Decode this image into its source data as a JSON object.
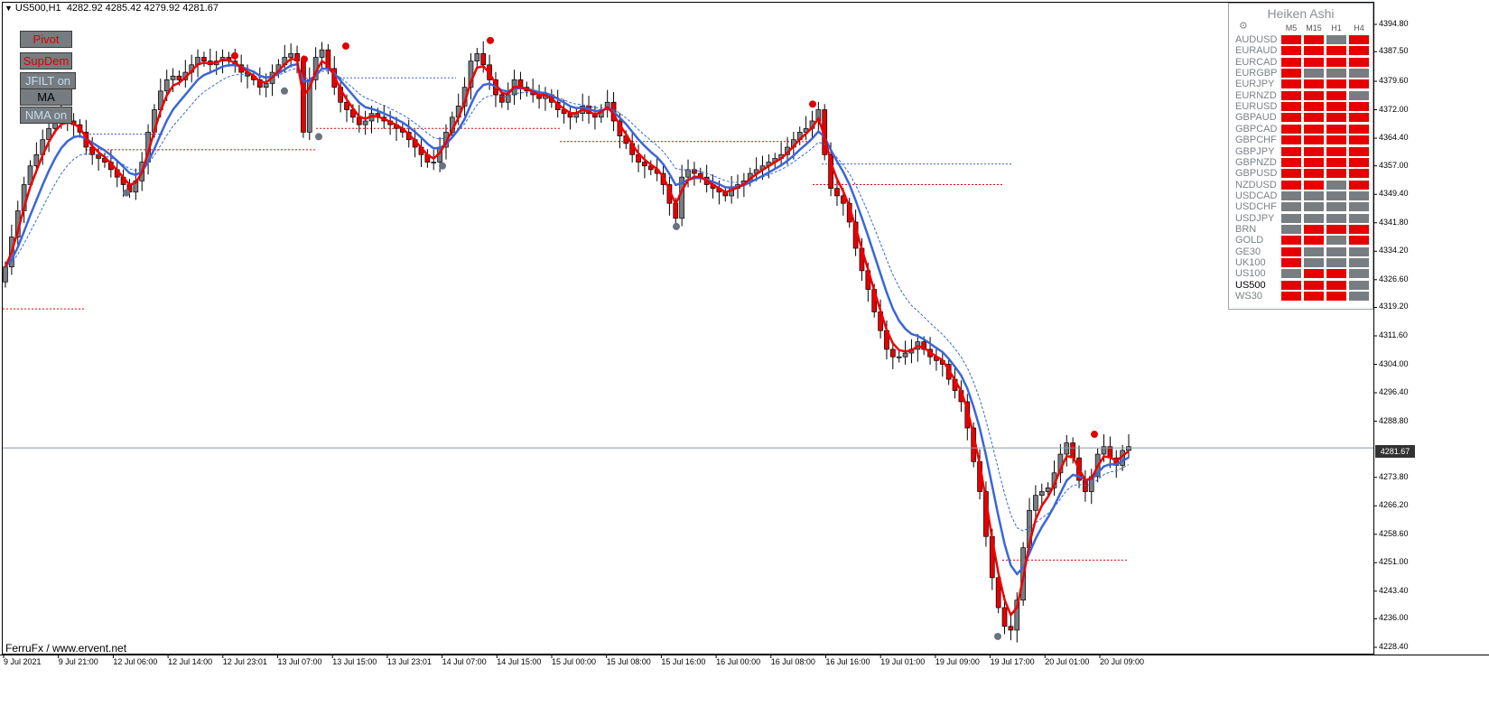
{
  "header": {
    "symbol": "US500,H1",
    "ohlc": "4282.92 4285.42 4279.92 4281.67"
  },
  "indicator_buttons": [
    {
      "label": "Pivot",
      "color": "#e00000"
    },
    {
      "label": "SupDem",
      "color": "#e00000"
    },
    {
      "label": "JFILT on",
      "color": "#c6dcf0"
    },
    {
      "label": "MA",
      "color": "#000000"
    },
    {
      "label": "NMA on",
      "color": "#c6dcf0"
    }
  ],
  "credit": "FerruFx / www.ervent.net",
  "current_price": "4281.67",
  "colors": {
    "bull": "#e60000",
    "neutral": "#787d82",
    "ma_red": "#ee0000",
    "ma_blue": "#3a66d6"
  },
  "heiken_ashi": {
    "title": "Heiken Ashi",
    "gear_icon": "⚙",
    "timeframes": [
      "M5",
      "M15",
      "H1",
      "H4"
    ],
    "active_symbol": "US500",
    "rows": [
      {
        "symbol": "AUDUSD",
        "cells": [
          "R",
          "R",
          "G",
          "R"
        ]
      },
      {
        "symbol": "EURAUD",
        "cells": [
          "R",
          "R",
          "R",
          "R"
        ]
      },
      {
        "symbol": "EURCAD",
        "cells": [
          "R",
          "R",
          "R",
          "R"
        ]
      },
      {
        "symbol": "EURGBP",
        "cells": [
          "R",
          "G",
          "G",
          "G"
        ]
      },
      {
        "symbol": "EURJPY",
        "cells": [
          "R",
          "R",
          "R",
          "R"
        ]
      },
      {
        "symbol": "EURNZD",
        "cells": [
          "R",
          "R",
          "R",
          "G"
        ]
      },
      {
        "symbol": "EURUSD",
        "cells": [
          "R",
          "R",
          "R",
          "R"
        ]
      },
      {
        "symbol": "GBPAUD",
        "cells": [
          "R",
          "R",
          "R",
          "R"
        ]
      },
      {
        "symbol": "GBPCAD",
        "cells": [
          "R",
          "R",
          "R",
          "R"
        ]
      },
      {
        "symbol": "GBPCHF",
        "cells": [
          "R",
          "R",
          "R",
          "R"
        ]
      },
      {
        "symbol": "GBPJPY",
        "cells": [
          "R",
          "R",
          "R",
          "R"
        ]
      },
      {
        "symbol": "GBPNZD",
        "cells": [
          "R",
          "R",
          "R",
          "R"
        ]
      },
      {
        "symbol": "GBPUSD",
        "cells": [
          "R",
          "R",
          "R",
          "R"
        ]
      },
      {
        "symbol": "NZDUSD",
        "cells": [
          "R",
          "R",
          "G",
          "R"
        ]
      },
      {
        "symbol": "USDCAD",
        "cells": [
          "G",
          "G",
          "G",
          "G"
        ]
      },
      {
        "symbol": "USDCHF",
        "cells": [
          "G",
          "G",
          "G",
          "G"
        ]
      },
      {
        "symbol": "USDJPY",
        "cells": [
          "G",
          "G",
          "G",
          "G"
        ]
      },
      {
        "symbol": "BRN",
        "cells": [
          "G",
          "R",
          "R",
          "R"
        ]
      },
      {
        "symbol": "GOLD",
        "cells": [
          "R",
          "R",
          "G",
          "R"
        ]
      },
      {
        "symbol": "GE30",
        "cells": [
          "R",
          "G",
          "G",
          "G"
        ]
      },
      {
        "symbol": "UK100",
        "cells": [
          "R",
          "G",
          "G",
          "G"
        ]
      },
      {
        "symbol": "US100",
        "cells": [
          "G",
          "R",
          "R",
          "G"
        ]
      },
      {
        "symbol": "US500",
        "cells": [
          "R",
          "R",
          "R",
          "G"
        ]
      },
      {
        "symbol": "WS30",
        "cells": [
          "R",
          "R",
          "R",
          "G"
        ]
      }
    ]
  },
  "price_axis": [
    "4394.80",
    "4387.50",
    "4379.60",
    "4372.00",
    "4364.40",
    "4357.00",
    "4349.40",
    "4341.80",
    "4334.20",
    "4326.60",
    "4319.20",
    "4311.60",
    "4304.00",
    "4296.40",
    "4288.80",
    "4281.67",
    "4273.80",
    "4266.20",
    "4258.60",
    "4251.00",
    "4243.40",
    "4236.00",
    "4228.40"
  ],
  "time_axis": [
    "9 Jul 2021",
    "9 Jul 21:00",
    "12 Jul 06:00",
    "12 Jul 14:00",
    "12 Jul 23:01",
    "13 Jul 07:00",
    "13 Jul 15:00",
    "13 Jul 23:01",
    "14 Jul 07:00",
    "14 Jul 15:00",
    "15 Jul 00:00",
    "15 Jul 08:00",
    "15 Jul 16:00",
    "16 Jul 00:00",
    "16 Jul 08:00",
    "16 Jul 16:00",
    "19 Jul 01:00",
    "19 Jul 09:00",
    "19 Jul 17:00",
    "20 Jul 01:00",
    "20 Jul 09:00"
  ],
  "chart_data": {
    "type": "candlestick",
    "title": "US500,H1",
    "ylim": [
      4228.4,
      4394.8
    ],
    "pivot_highs": [
      4386.4,
      4385.5,
      4389.0,
      4390.5,
      4373.5,
      4285.3
    ],
    "pivot_lows": [
      4349.8,
      4377.0,
      4364.8,
      4357.0,
      4340.8,
      4231.3
    ],
    "supdem_levels": [
      4318.8,
      4361.3,
      4367.0,
      4363.5,
      4352.0,
      4251.7
    ],
    "nma_levels": [
      4365.5,
      4380.5,
      4357.5
    ],
    "close": [
      4330,
      4338,
      4345,
      4352,
      4357,
      4360,
      4364,
      4367,
      4369,
      4370,
      4369,
      4368,
      4366,
      4362,
      4360,
      4359,
      4358,
      4356,
      4354,
      4352,
      4350,
      4353,
      4358,
      4366,
      4372,
      4377,
      4380,
      4381,
      4380,
      4382,
      4384,
      4386,
      4385,
      4384,
      4385,
      4386,
      4385,
      4384,
      4382,
      4381,
      4380,
      4378,
      4379,
      4382,
      4384,
      4386,
      4387,
      4385,
      4366,
      4380,
      4386,
      4388,
      4383,
      4378,
      4374,
      4372,
      4370,
      4368,
      4369,
      4371,
      4370,
      4369,
      4368,
      4367,
      4366,
      4364,
      4362,
      4360,
      4358,
      4358,
      4362,
      4366,
      4370,
      4373,
      4378,
      4385,
      4387,
      4384,
      4380,
      4376,
      4374,
      4376,
      4380,
      4378,
      4377,
      4376,
      4375,
      4376,
      4374,
      4372,
      4371,
      4370,
      4371,
      4373,
      4371,
      4370,
      4372,
      4374,
      4369,
      4365,
      4363,
      4360,
      4358,
      4357,
      4356,
      4355,
      4352,
      4347,
      4343,
      4354,
      4356,
      4355,
      4354,
      4352,
      4351,
      4350,
      4349,
      4351,
      4352,
      4353,
      4355,
      4356,
      4357,
      4358,
      4359,
      4360,
      4362,
      4364,
      4366,
      4367,
      4369,
      4372,
      4360,
      4351,
      4349,
      4347,
      4342,
      4335,
      4329,
      4324,
      4318,
      4313,
      4308,
      4306,
      4306,
      4307,
      4308,
      4310,
      4308,
      4306,
      4305,
      4304,
      4300,
      4297,
      4294,
      4287,
      4278,
      4270,
      4258,
      4247,
      4239,
      4234,
      4233,
      4241,
      4255,
      4265,
      4269,
      4270,
      4271,
      4275,
      4280,
      4283,
      4279,
      4273,
      4270,
      4274,
      4280,
      4282,
      4279,
      4277,
      4281,
      4282
    ]
  }
}
